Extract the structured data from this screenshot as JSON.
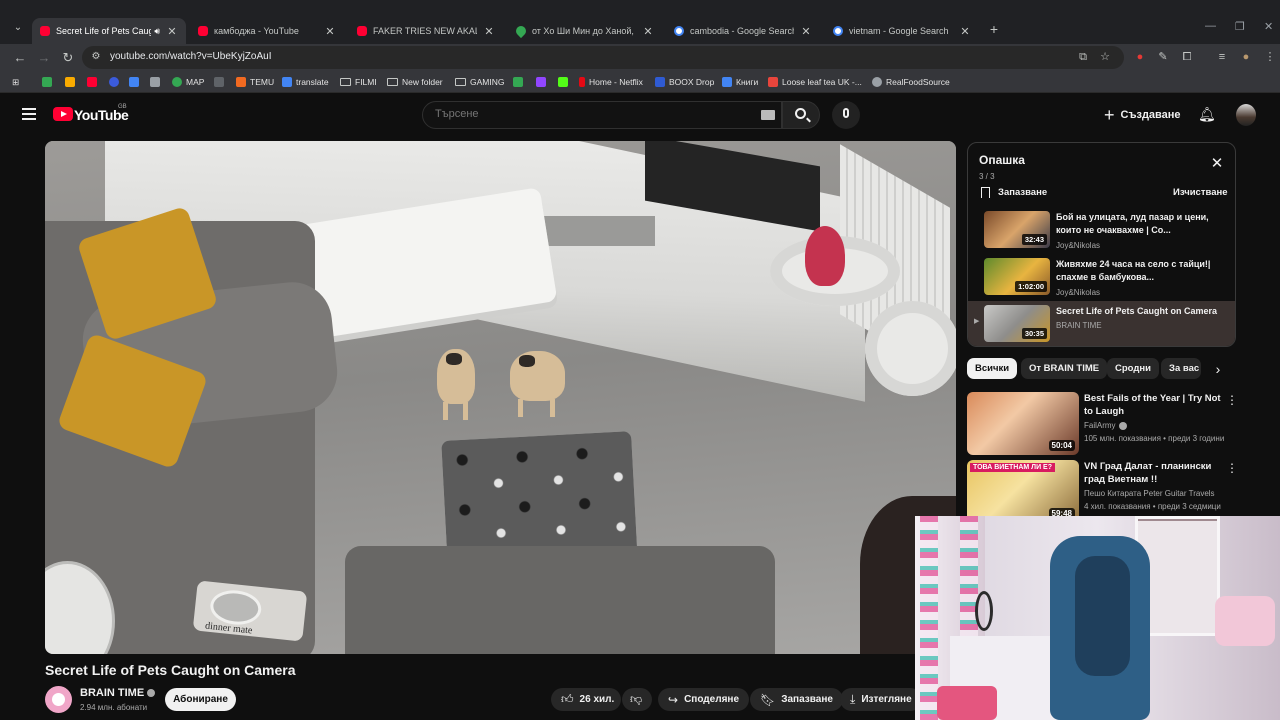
{
  "browser": {
    "tabs": [
      {
        "title": "Secret Life of Pets Caught o",
        "favicon": "youtube-icon",
        "active": true,
        "audio": true
      },
      {
        "title": "камбоджа - YouTube",
        "favicon": "youtube-icon",
        "active": false
      },
      {
        "title": "FAKER TRIES NEW AKALI BUILD",
        "favicon": "youtube-icon",
        "active": false
      },
      {
        "title": "от Хо Ши Мин до Ханой, На М",
        "favicon": "maps-icon",
        "active": false
      },
      {
        "title": "cambodia - Google Search",
        "favicon": "google-icon",
        "active": false
      },
      {
        "title": "vietnam - Google Search",
        "favicon": "google-icon",
        "active": false
      }
    ],
    "url": "youtube.com/watch?v=UbeKyjZoAuI",
    "bookmarks": [
      {
        "label": "",
        "icon": "bookmark-green-icon",
        "color": "#34a853"
      },
      {
        "label": "",
        "icon": "bookmark-folder-yellow-icon",
        "color": "#f9ab00"
      },
      {
        "label": "",
        "icon": "youtube-icon",
        "color": "#ff0033"
      },
      {
        "label": "",
        "icon": "bookmark-swirl-icon",
        "color": "#3b5bdb"
      },
      {
        "label": "",
        "icon": "bookmark-blue-icon",
        "color": "#4285f4"
      },
      {
        "label": "",
        "icon": "bookmark-grey-icon",
        "color": "#9aa0a6"
      },
      {
        "label": "MAP",
        "icon": "maps-icon",
        "color": "#34a853"
      },
      {
        "label": "",
        "icon": "bookmark-dark-icon",
        "color": "#5f6368"
      },
      {
        "label": "TEMU",
        "icon": "temu-icon",
        "color": "#f26a21"
      },
      {
        "label": "translate",
        "icon": "translate-icon",
        "color": "#4285f4"
      },
      {
        "label": "FILMI",
        "icon": "folder-icon"
      },
      {
        "label": "New folder",
        "icon": "folder-icon"
      },
      {
        "label": "GAMING",
        "icon": "folder-icon"
      },
      {
        "label": "",
        "icon": "bookmark-signal-icon",
        "color": "#34a853"
      },
      {
        "label": "",
        "icon": "twitch-icon",
        "color": "#9146ff"
      },
      {
        "label": "",
        "icon": "kick-icon",
        "color": "#53fc18"
      },
      {
        "label": "Home - Netflix",
        "icon": "netflix-icon",
        "color": "#e50914"
      },
      {
        "label": "BOOX Drop",
        "icon": "boox-icon",
        "color": "#2f5bd3"
      },
      {
        "label": "Книги",
        "icon": "book-icon",
        "color": "#4285f4"
      },
      {
        "label": "Loose leaf tea UK -...",
        "icon": "tea-icon",
        "color": "#e8453c"
      },
      {
        "label": "RealFoodSource",
        "icon": "globe-icon",
        "color": "#9aa0a6"
      }
    ]
  },
  "youtube": {
    "wordmark": "YouTube",
    "country": "GB",
    "search_placeholder": "Търсене",
    "create_label": "Създаване"
  },
  "video": {
    "title": "Secret Life of Pets Caught on Camera",
    "channel": "BRAIN TIME",
    "subscribers": "2.94 млн. абонати",
    "subscribe_label": "Абониране",
    "likes": "26 хил.",
    "share_label": "Споделяне",
    "save_label": "Запазване",
    "download_label": "Изтегляне",
    "bowl_text": "dinner mate"
  },
  "queue": {
    "title": "Опашка",
    "count": "3 / 3",
    "save_label": "Запазване",
    "clear_label": "Изчистване",
    "items": [
      {
        "title": "Бой на улицата, луд пазар и цени, които не очаквахме | Со...",
        "channel": "Joy&Nikolas",
        "duration": "32:43",
        "current": false
      },
      {
        "title": "Живяхме 24 часа на село с тайци!| спахме в бамбукова...",
        "channel": "Joy&Nikolas",
        "duration": "1:02:00",
        "current": false
      },
      {
        "title": "Secret Life of Pets Caught on Camera",
        "channel": "BRAIN TIME",
        "duration": "30:35",
        "current": true
      }
    ]
  },
  "chips": [
    "Всички",
    "От BRAIN TIME",
    "Сродни",
    "За вас"
  ],
  "recommendations": [
    {
      "title": "Best Fails of the Year | Try Not to Laugh",
      "channel": "FailArmy",
      "verified": true,
      "meta": "105 млн. показвания • преди 3 години",
      "duration": "50:04"
    },
    {
      "title": "VN Град Далат - планински град Виетнам !!",
      "channel": "Пешо Китарата Peter Guitar Travels",
      "verified": false,
      "meta": "4 хил. показвания • преди 3 седмици",
      "duration": "59:48",
      "thumb_caption": "ТОВА ВИЕТНАМ ЛИ Е?"
    }
  ],
  "colors": {
    "youtube_red": "#ff0033",
    "background": "#0f0f0f",
    "chip": "#272727",
    "queue_current": "#3a3230"
  }
}
